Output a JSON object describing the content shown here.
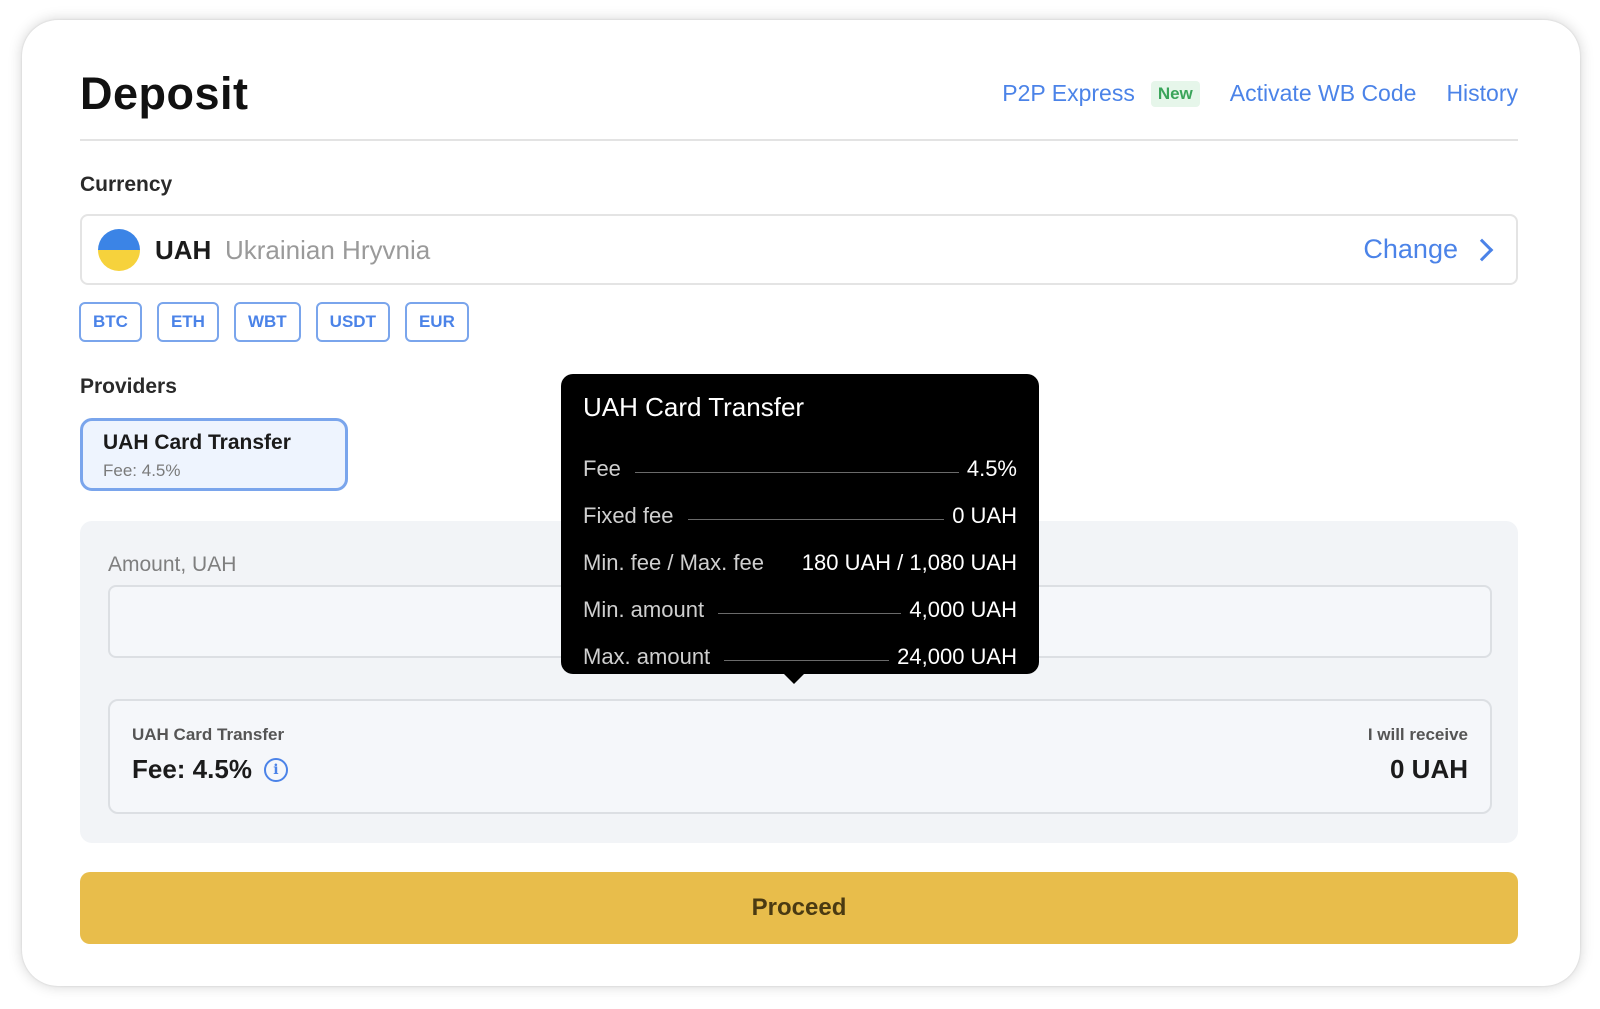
{
  "header": {
    "title": "Deposit",
    "links": {
      "p2p_express": "P2P Express",
      "new_badge": "New",
      "activate_code": "Activate WB Code",
      "history": "History"
    }
  },
  "currency": {
    "section_label": "Currency",
    "code": "UAH",
    "name": "Ukrainian Hryvnia",
    "flag_icon": "ukraine-flag-icon",
    "change_label": "Change",
    "quick_chips": [
      "BTC",
      "ETH",
      "WBT",
      "USDT",
      "EUR"
    ]
  },
  "providers": {
    "section_label": "Providers",
    "selected": {
      "name": "UAH Card Transfer",
      "fee": "Fee: 4.5%"
    }
  },
  "amount": {
    "label": "Amount, UAH",
    "value": ""
  },
  "summary": {
    "provider": "UAH Card Transfer",
    "fee": "Fee: 4.5%",
    "receive_label": "I will receive",
    "receive_value": "0 UAH"
  },
  "tooltip": {
    "title": "UAH Card Transfer",
    "rows": [
      {
        "key": "Fee",
        "value": "4.5%"
      },
      {
        "key": "Fixed fee",
        "value": "0 UAH"
      },
      {
        "key": "Min. fee / Max. fee",
        "value": "180 UAH / 1,080 UAH"
      },
      {
        "key": "Min. amount",
        "value": "4,000 UAH"
      },
      {
        "key": "Max. amount",
        "value": "24,000 UAH"
      }
    ]
  },
  "actions": {
    "proceed": "Proceed"
  },
  "colors": {
    "accent_blue": "#4b83e8",
    "proceed_yellow": "#e8bd4b",
    "new_badge_green": "#3aa45a"
  }
}
